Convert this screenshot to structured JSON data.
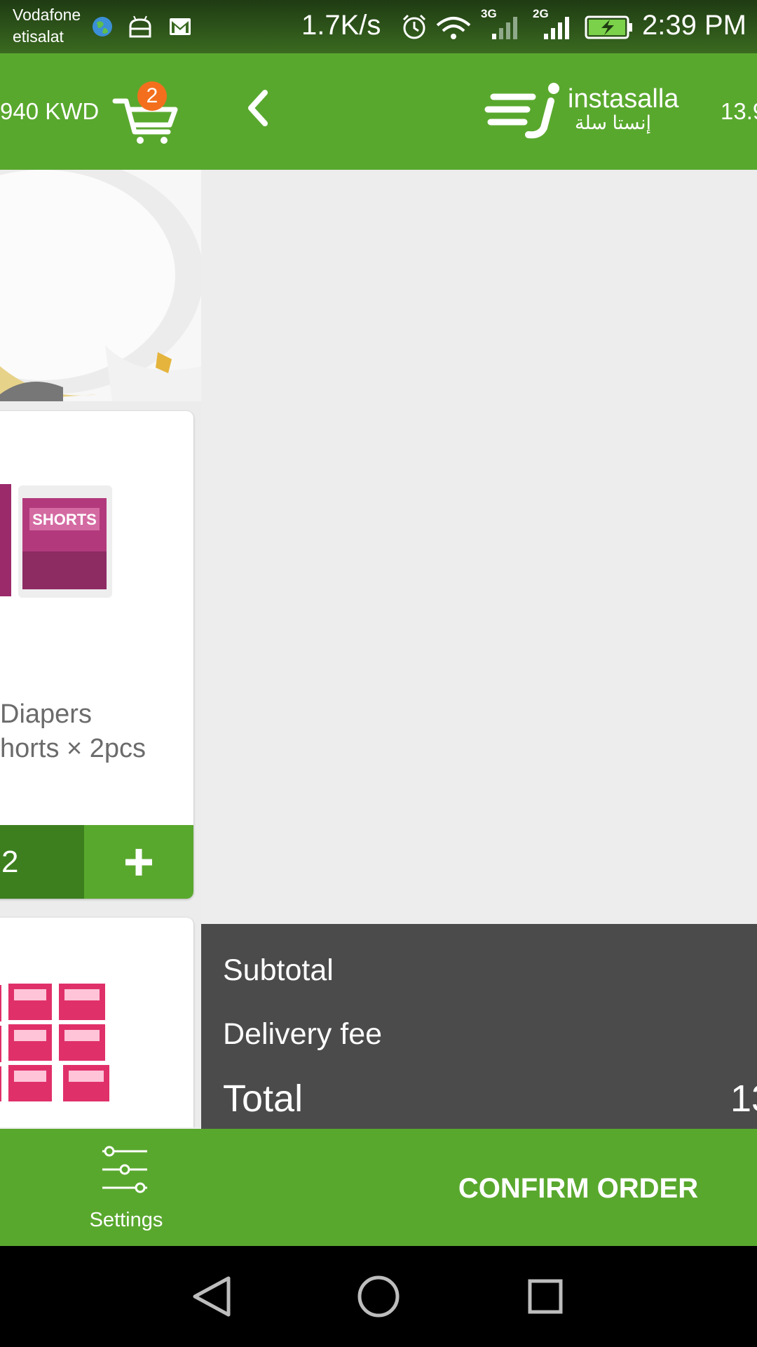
{
  "status_bar": {
    "carrier_1": "Vodafone",
    "carrier_2": "etisalat",
    "net_speed": "1.7K/s",
    "network_1": "3G",
    "network_2": "2G",
    "time": "2:39 PM",
    "icons": [
      "globe-icon",
      "android-icon",
      "gmail-icon",
      "alarm-icon",
      "wifi-icon",
      "signal-icon",
      "battery-charging-icon"
    ]
  },
  "header": {
    "cart_total_left": "940 KWD",
    "cart_count": "2",
    "logo_text": "instasalla",
    "logo_arabic": "إنستا سلة",
    "price_right": "13.9",
    "colors": {
      "bar": "#59a82e",
      "badge": "#f36f1d"
    }
  },
  "products": [
    {
      "name_line_1": "Diapers",
      "name_line_2": "horts × 2pcs",
      "image_label": "SHORTS",
      "quantity": "2",
      "plus_label": "+"
    }
  ],
  "summary": {
    "subtotal_label": "Subtotal",
    "delivery_label": "Delivery fee",
    "total_label": "Total",
    "total_value": "13"
  },
  "bottom_bar": {
    "settings_label": "Settings",
    "confirm_label": "CONFIRM ORDER"
  },
  "nav": {
    "icons": [
      "back-triangle-icon",
      "home-circle-icon",
      "recents-square-icon"
    ]
  }
}
